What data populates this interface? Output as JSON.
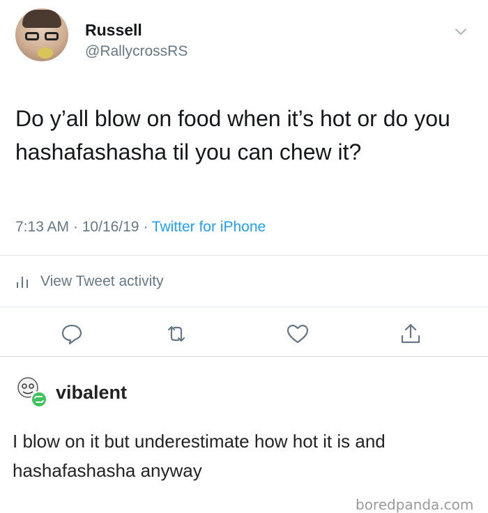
{
  "tweet": {
    "display_name": "Russell",
    "handle": "@RallycrossRS",
    "text": "Do y’all blow on food when it’s hot or do you hashafashasha til you can chew it?",
    "time": "7:13 AM",
    "separator": " · ",
    "date": "10/16/19",
    "source": "Twitter for iPhone",
    "activity_label": "View Tweet activity"
  },
  "actions": {
    "reply_icon": "speech-bubble-icon",
    "retweet_icon": "retweet-arrows-icon",
    "like_icon": "heart-icon",
    "share_icon": "share-up-arrow-icon"
  },
  "reply": {
    "username": "vibalent",
    "text": "I blow on it but underestimate how hot it is and hashafashasha anyway"
  },
  "watermark": "boredpanda.com",
  "colors": {
    "link_blue": "#1da1f2",
    "meta_gray": "#657786",
    "divider": "#e1e8ed",
    "reblog_green": "#3fc35d"
  }
}
